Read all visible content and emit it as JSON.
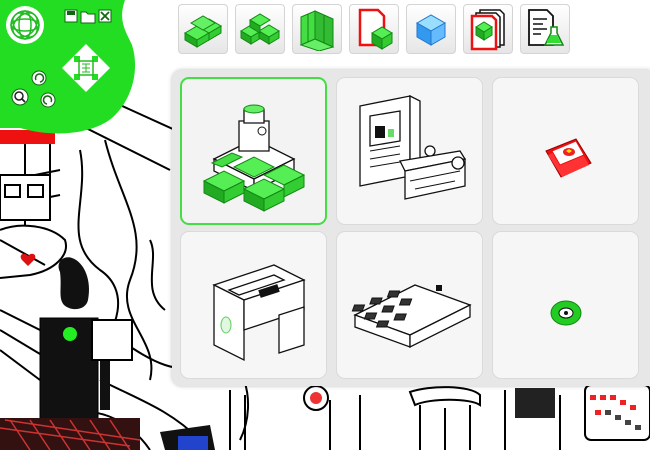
{
  "colors": {
    "accent": "#22dd22",
    "accent_dark": "#117711",
    "alert_red": "#ee1111",
    "panel_bg": "#e7e7e7",
    "tile_bg": "#f6f6f6"
  },
  "nav_disc": {
    "icons": [
      "logo-sphere-icon",
      "save-icon",
      "folder-icon",
      "close-icon",
      "pan-arrows-icon",
      "zoom-icon",
      "rotate-left-icon",
      "rotate-right-icon"
    ]
  },
  "toolbar": {
    "tools": [
      {
        "icon": "blocks-cluster-icon"
      },
      {
        "icon": "blocks-arrangement-icon"
      },
      {
        "icon": "wall-panels-icon"
      },
      {
        "icon": "document-block-icon"
      },
      {
        "icon": "glass-cube-icon"
      },
      {
        "icon": "document-stack-icon"
      },
      {
        "icon": "document-flask-icon"
      }
    ]
  },
  "catalog": {
    "selected_index": 0,
    "items": [
      {
        "icon": "bottle-with-blocks-icon"
      },
      {
        "icon": "machine-cabinet-icon"
      },
      {
        "icon": "red-booklet-icon"
      },
      {
        "icon": "desk-console-icon"
      },
      {
        "icon": "keypad-tray-icon"
      },
      {
        "icon": "green-disc-icon"
      }
    ]
  }
}
